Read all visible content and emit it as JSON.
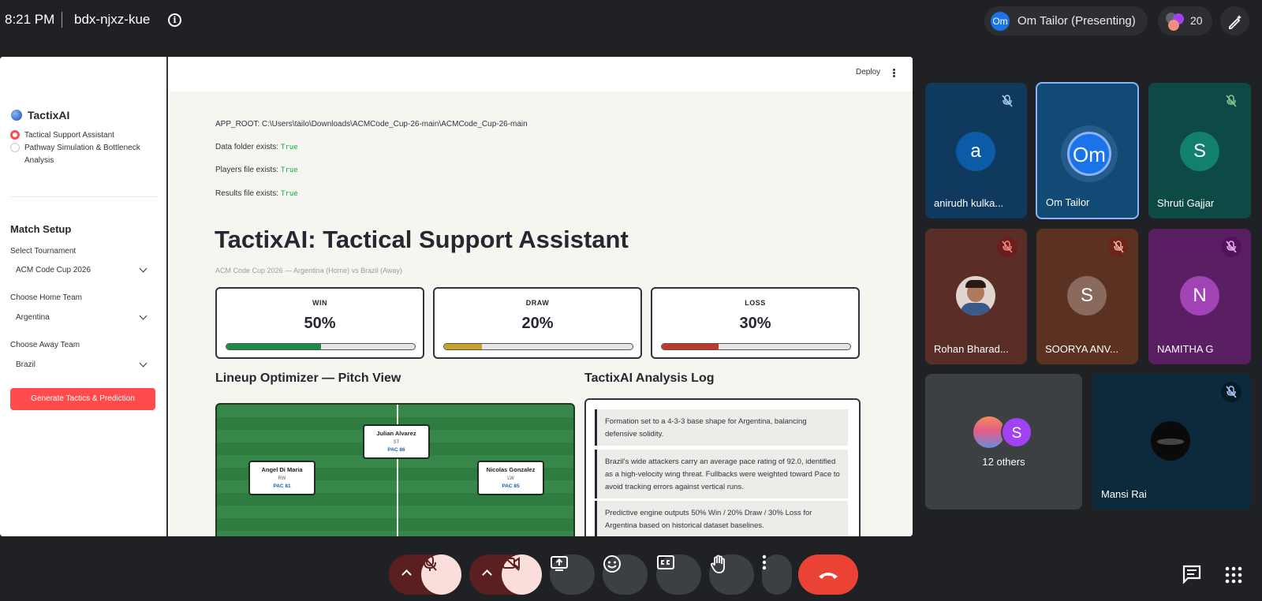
{
  "meeting": {
    "time": "8:21 PM",
    "code": "bdx-njxz-kue",
    "presenter_initials": "Om",
    "presenter_label": "Om Tailor (Presenting)",
    "participant_count": "20"
  },
  "app": {
    "sidebar": {
      "brand": "TactixAI",
      "nav": [
        {
          "label": "Tactical Support Assistant",
          "selected": true
        },
        {
          "label": "Pathway Simulation & Bottleneck Analysis",
          "selected": false
        }
      ],
      "heading": "Match Setup",
      "tournament_label": "Select Tournament",
      "tournament_value": "ACM Code Cup 2026",
      "home_label": "Choose Home Team",
      "home_value": "Argentina",
      "away_label": "Choose Away Team",
      "away_value": "Brazil",
      "button": "Generate Tactics & Prediction"
    },
    "header": {
      "deploy": "Deploy"
    },
    "diagnostics": {
      "app_root": "APP_ROOT: C:\\Users\\tailo\\Downloads\\ACMCode_Cup-26-main\\ACMCode_Cup-26-main",
      "data_label": "Data folder exists:",
      "data_value": "True",
      "players_label": "Players file exists:",
      "players_value": "True",
      "results_label": "Results file exists:",
      "results_value": "True"
    },
    "title": "TactixAI: Tactical Support Assistant",
    "caption": "ACM Code Cup 2026 — Argentina (Home) vs Brazil (Away)",
    "metrics": [
      {
        "label": "WIN",
        "value": "50%",
        "fraction": 0.5,
        "color": "#1e8a47"
      },
      {
        "label": "DRAW",
        "value": "20%",
        "fraction": 0.2,
        "color": "#c9a227"
      },
      {
        "label": "LOSS",
        "value": "30%",
        "fraction": 0.3,
        "color": "#c0392b"
      }
    ],
    "pitch_heading": "Lineup Optimizer — Pitch View",
    "players": [
      {
        "name": "Julian Alvarez",
        "pos": "ST",
        "pac": "PAC 86"
      },
      {
        "name": "Angel Di Maria",
        "pos": "RW",
        "pac": "PAC 81"
      },
      {
        "name": "Nicolas Gonzalez",
        "pos": "LW",
        "pac": "PAC 85"
      }
    ],
    "log_heading": "TactixAI Analysis Log",
    "log": [
      "Formation set to a 4-3-3 base shape for Argentina, balancing defensive solidity.",
      "Brazil's wide attackers carry an average pace rating of 92.0, identified as a high-velocity wing threat. Fullbacks were weighted toward Pace to avoid tracking errors against vertical runs.",
      "Predictive engine outputs 50% Win / 20% Draw / 30% Loss for Argentina based on historical dataset baselines."
    ]
  },
  "participants": [
    {
      "initial": "a",
      "name": "anirudh kulka...",
      "muted": true,
      "tile_color": "#0f3a5e",
      "avatar_color": "#0d5aa7"
    },
    {
      "initial": "Om",
      "name": "Om Tailor",
      "muted": false,
      "tile_color": "#114a74",
      "avatar_color": "#1a73e8"
    },
    {
      "initial": "S",
      "name": "Shruti Gajjar",
      "muted": true,
      "tile_color": "#0d4a45",
      "avatar_color": "#12806f"
    },
    {
      "initial": "",
      "name": "Rohan Bharad...",
      "muted": true,
      "tile_color": "#5a2e27",
      "avatar_color": "#e0d6cf"
    },
    {
      "initial": "S",
      "name": "SOORYA ANV...",
      "muted": true,
      "tile_color": "#5b3222",
      "avatar_color": "#8a6a5c"
    },
    {
      "initial": "N",
      "name": "NAMITHA G",
      "muted": true,
      "tile_color": "#5a1e63",
      "avatar_color": "#a142b5"
    },
    {
      "initial": "S",
      "name": "12 others",
      "muted": false,
      "tile_color": "#3c4043",
      "avatar_color": "#a142f4"
    },
    {
      "initial": "",
      "name": "Mansi Rai",
      "muted": true,
      "tile_color": "#0c2a3c",
      "avatar_color": "#111111"
    }
  ]
}
